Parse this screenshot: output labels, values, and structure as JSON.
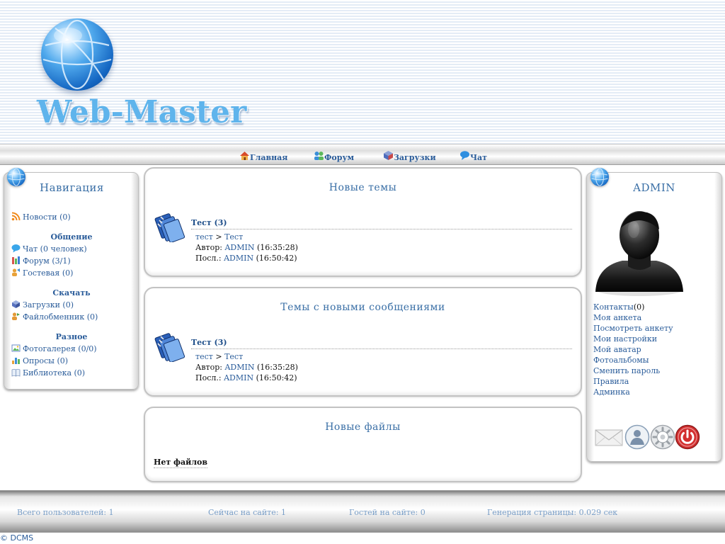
{
  "site": {
    "logo_text": "Web-Master",
    "brand_color": "#5fb4ec",
    "link_color": "#2a5c9a"
  },
  "topmenu": [
    {
      "label": "Главная",
      "icon": "home-icon"
    },
    {
      "label": "Форум",
      "icon": "forum-icon"
    },
    {
      "label": "Загрузки",
      "icon": "downloads-icon"
    },
    {
      "label": "Чат",
      "icon": "chat-icon"
    }
  ],
  "navigation": {
    "title": "Навигация",
    "news": {
      "label": "Новости",
      "count": "(0)"
    },
    "sections": [
      {
        "title": "Общение",
        "items": [
          {
            "label": "Чат",
            "count": "(0 человек)"
          },
          {
            "label": "Форум",
            "count": "(3/1)"
          },
          {
            "label": "Гостевая",
            "count": "(0)"
          }
        ]
      },
      {
        "title": "Скачать",
        "items": [
          {
            "label": "Загрузки",
            "count": "(0)"
          },
          {
            "label": "Файлобменник",
            "count": "(0)"
          }
        ]
      },
      {
        "title": "Разное",
        "items": [
          {
            "label": "Фотогалерея",
            "count": "(0/0)"
          },
          {
            "label": "Опросы",
            "count": "(0)"
          },
          {
            "label": "Библиотека",
            "count": "(0)"
          }
        ]
      }
    ]
  },
  "new_topics": {
    "title": "Новые темы",
    "topic": {
      "title": "Тест (3)",
      "crumb_forum": "тест",
      "crumb_sep": ">",
      "crumb_topic": "Тест",
      "author_label": "Автор:",
      "author": "ADMIN",
      "author_time": "(16:35:28)",
      "last_label": "Посл.:",
      "last_user": "ADMIN",
      "last_time": "(16:50:42)"
    }
  },
  "topics_new_messages": {
    "title": "Темы с новыми сообщениями",
    "topic": {
      "title": "Тест (3)",
      "crumb_forum": "тест",
      "crumb_sep": ">",
      "crumb_topic": "Тест",
      "author_label": "Автор:",
      "author": "ADMIN",
      "author_time": "(16:35:28)",
      "last_label": "Посл.:",
      "last_user": "ADMIN",
      "last_time": "(16:50:42)"
    }
  },
  "new_files": {
    "title": "Новые файлы",
    "empty_text": "Нет файлов"
  },
  "user_panel": {
    "title": "ADMIN",
    "contacts_label": "Контакты",
    "contacts_count": "(0)",
    "links": [
      "Моя анкета",
      "Посмотреть анкету",
      "Мои настройки",
      "Мой аватар",
      "Фотоальбомы",
      "Сменить пароль",
      "Правила",
      "Админка"
    ],
    "icons": [
      "mail-icon",
      "user-icon",
      "settings-gear-icon",
      "power-icon"
    ]
  },
  "footer": {
    "total_users": "Всего пользователей: 1",
    "online_now": "Сейчас на сайте: 1",
    "guests": "Гостей на сайте: 0",
    "generation": "Генерация страницы: 0.029 сек",
    "copyright": "© DCMS"
  }
}
